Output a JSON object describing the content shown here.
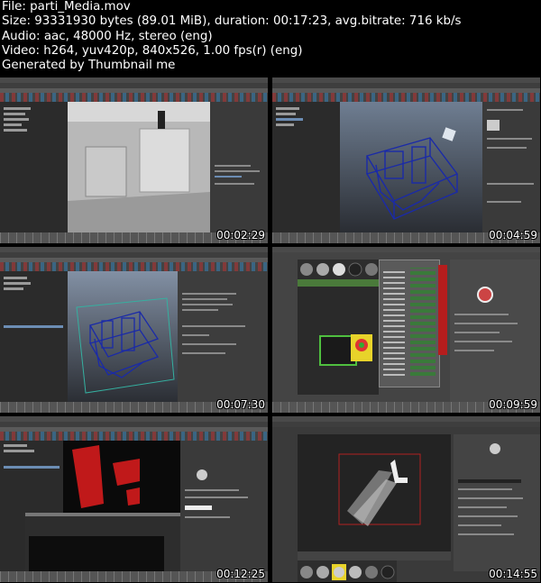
{
  "header": {
    "file_line": "File: parti_Media.mov",
    "size_line": "Size: 93331930 bytes (89.01 MiB), duration: 00:17:23, avg.bitrate: 716 kb/s",
    "audio_line": "Audio: aac, 48000 Hz, stereo (eng)",
    "video_line": "Video: h264, yuv420p, 840x526, 1.00 fps(r) (eng)",
    "generated_line": "Generated by Thumbnail me"
  },
  "thumbnails": [
    {
      "timestamp": "00:02:29",
      "content": "kitchen-render-viewport"
    },
    {
      "timestamp": "00:04:59",
      "content": "kitchen-wireframe-viewport"
    },
    {
      "timestamp": "00:07:30",
      "content": "kitchen-wireframe-attribute-editor"
    },
    {
      "timestamp": "00:09:59",
      "content": "hypershade-material-editor"
    },
    {
      "timestamp": "00:12:25",
      "content": "render-view-red-mask"
    },
    {
      "timestamp": "00:14:55",
      "content": "viewport-plane-ramp"
    }
  ],
  "colors": {
    "background": "#000000",
    "text": "#ffffff",
    "wireframe": "#1a2aa8",
    "mask_red": "#c0191a",
    "swatch_yellow": "#e8d32a"
  }
}
